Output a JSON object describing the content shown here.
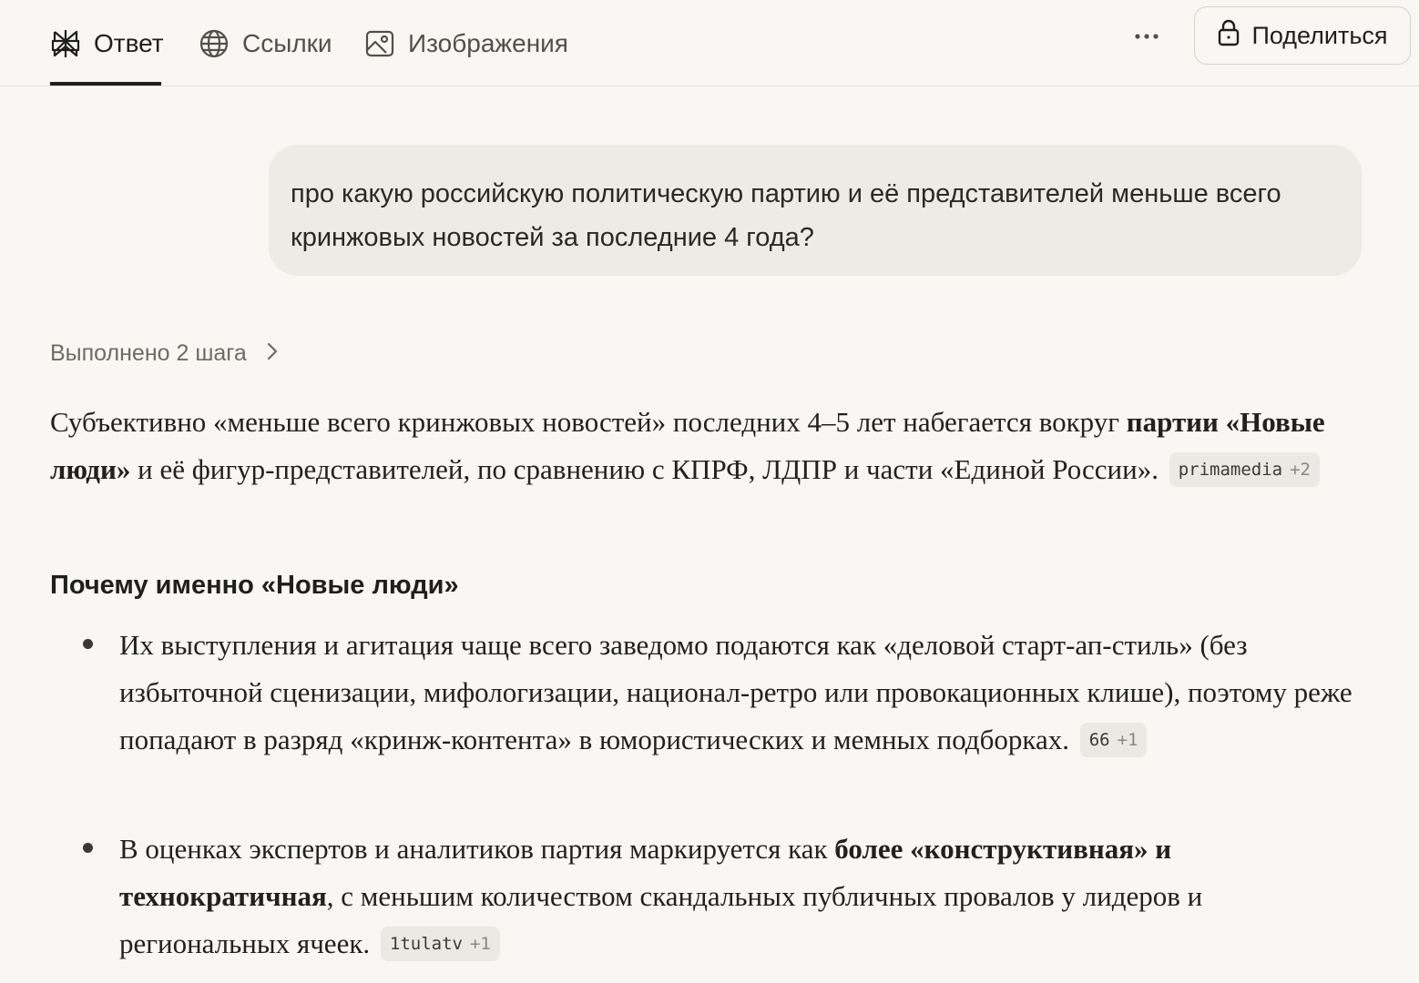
{
  "tabs": [
    {
      "label": "Ответ",
      "icon": "perplexity-logo-icon",
      "active": true
    },
    {
      "label": "Ссылки",
      "icon": "globe-icon",
      "active": false
    },
    {
      "label": "Изображения",
      "icon": "image-icon",
      "active": false
    }
  ],
  "header": {
    "more_icon": "ellipsis-icon",
    "share_label": "Поделиться",
    "share_icon": "lock-icon"
  },
  "query": {
    "text": "про какую российскую политическую партию и её представителей меньше всего кринжовых новостей за последние 4 года?"
  },
  "steps": {
    "label": "Выполнено 2 шага",
    "icon": "chevron-right-icon"
  },
  "answer": {
    "intro": {
      "part1": "Субъективно «меньше всего кринжовых новостей» последних 4–5 лет набегается вокруг ",
      "bold": "партии «Новые люди»",
      "part2": " и её фигур-представителей, по сравнению с КПРФ, ЛДПР и части «Единой России».",
      "cite_source": "primamedia",
      "cite_more": "+2"
    },
    "heading": "Почему именно «Новые люди»",
    "bullets": [
      {
        "text_before": "Их выступления и агитация чаще всего заведомо подаются как «деловой старт-ап-стиль» (без избыточной сценизации, мифологизации, национал-ретро или провокационных клише), поэтому реже попадают в разряд «кринж-контента» в юмористических и мемных подборках.",
        "bold": "",
        "text_after": "",
        "cite_source": "66",
        "cite_more": "+1"
      },
      {
        "text_before": "В оценках экспертов и аналитиков партия маркируется как ",
        "bold": "более «конструктивная» и технократичная",
        "text_after": ", с меньшим количеством скандальных публичных провалов у лидеров и региональных ячеек.",
        "cite_source": "1tulatv",
        "cite_more": "+1"
      }
    ]
  }
}
